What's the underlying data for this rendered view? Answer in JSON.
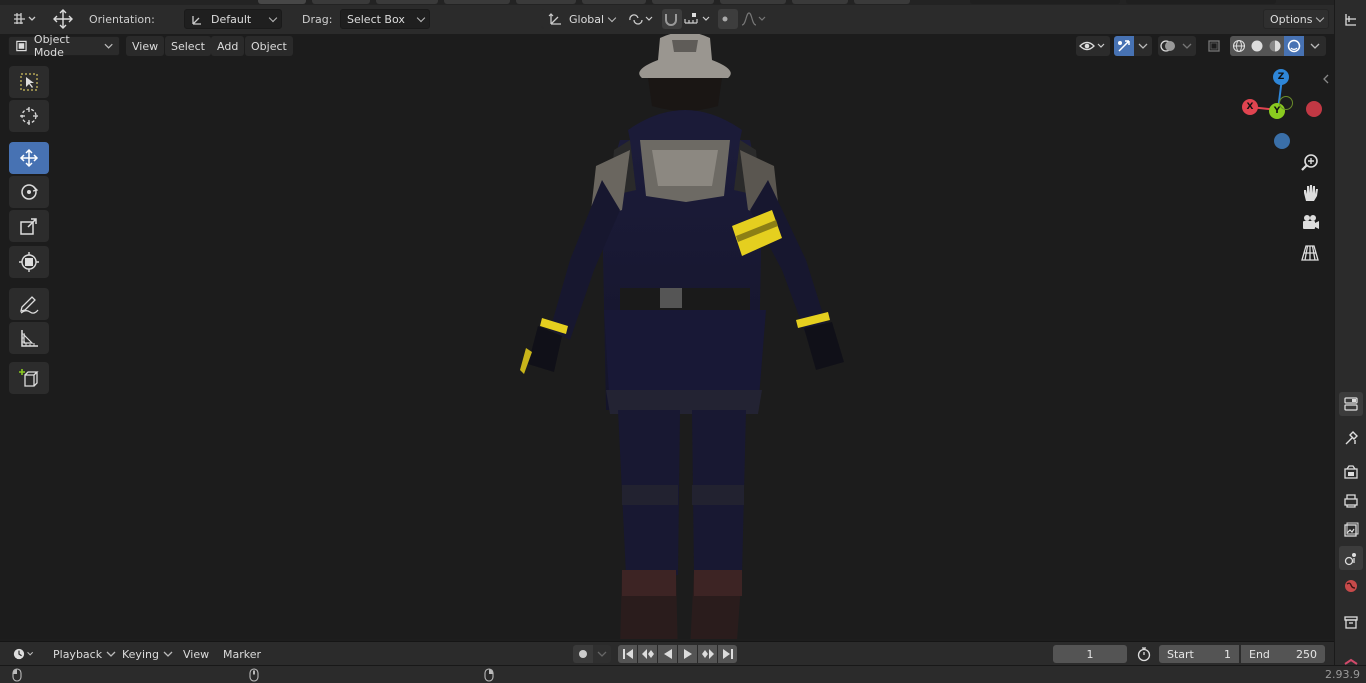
{
  "header": {
    "orientation_label": "Orientation:",
    "orientation_value": "Default",
    "drag_label": "Drag:",
    "drag_value": "Select Box",
    "transform_orientation": "Global",
    "options_label": "Options"
  },
  "viewport_header": {
    "mode": "Object Mode",
    "menus": [
      "View",
      "Select",
      "Add",
      "Object"
    ]
  },
  "toolbar": {
    "tools": [
      "select-box-tool",
      "cursor-tool",
      "move-tool",
      "rotate-tool",
      "scale-tool",
      "transform-tool",
      "annotate-tool",
      "measure-tool",
      "add-cube-tool"
    ],
    "active_tool": "move-tool"
  },
  "gizmo": {
    "x_label": "X",
    "y_label": "Y",
    "z_label": "Z"
  },
  "timeline": {
    "menus": [
      "Playback",
      "Keying",
      "View",
      "Marker"
    ],
    "current_frame": "1",
    "start_label": "Start",
    "start_value": "1",
    "end_label": "End",
    "end_value": "250"
  },
  "statusbar": {
    "version": "2.93.9"
  },
  "colors": {
    "accent": "#4772b3",
    "x_axis": "#e04450",
    "y_axis": "#8acb1f",
    "z_axis": "#2e86d8"
  }
}
